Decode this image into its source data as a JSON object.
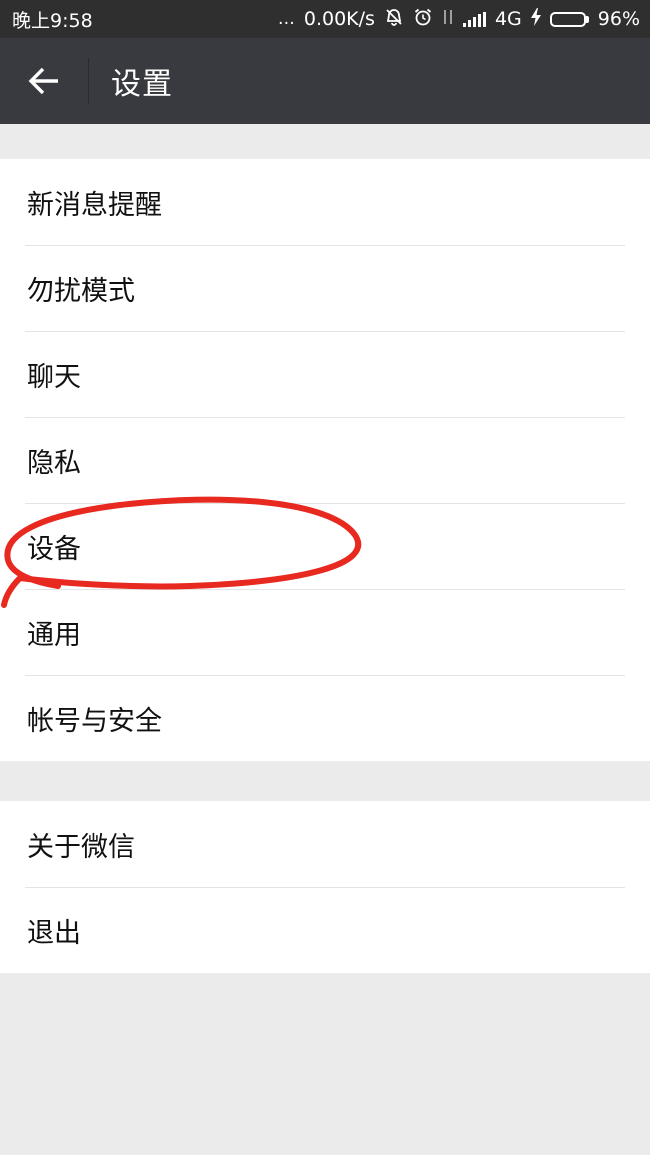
{
  "status_bar": {
    "time": "晚上9:58",
    "dots": "…",
    "net_speed": "0.00K/s",
    "network": "4G",
    "battery_percent": "96%",
    "battery_level": 0.96,
    "icons": [
      "mute-icon",
      "alarm-icon",
      "data-arrows-icon",
      "signal-icon",
      "charging-icon",
      "battery-icon"
    ]
  },
  "header": {
    "back_icon": "arrow-left-icon",
    "title": "设置"
  },
  "groups": [
    {
      "items": [
        {
          "label": "新消息提醒"
        },
        {
          "label": "勿扰模式"
        },
        {
          "label": "聊天"
        },
        {
          "label": "隐私"
        },
        {
          "label": "设备"
        },
        {
          "label": "通用"
        },
        {
          "label": "帐号与安全"
        }
      ]
    },
    {
      "items": [
        {
          "label": "关于微信"
        },
        {
          "label": "退出"
        }
      ]
    }
  ],
  "colors": {
    "status_bar_bg": "#2f2f2f",
    "title_bar_bg": "#393a3f",
    "page_bg": "#ebebeb",
    "annotation": "#e8291f",
    "battery": "#4cd964"
  }
}
